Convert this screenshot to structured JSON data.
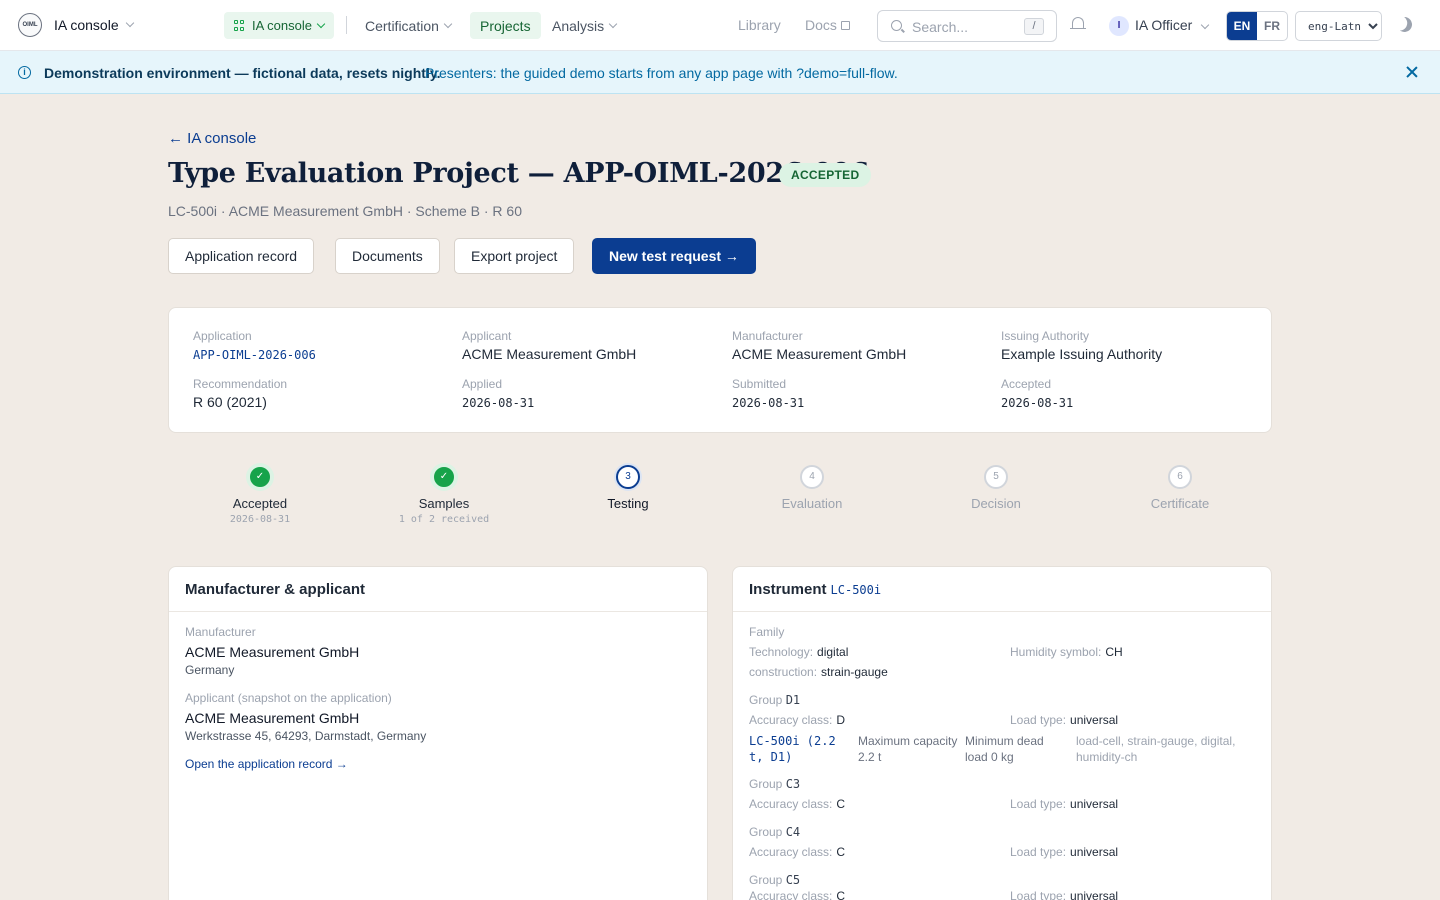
{
  "nav": {
    "logo_text": "OIML",
    "app_title": "IA console",
    "console_pill": "IA console",
    "links": [
      "Certification",
      "Projects",
      "Analysis"
    ],
    "library": "Library",
    "docs": "Docs",
    "search_placeholder": "Search...",
    "search_shortcut": "/",
    "avatar_initial": "I",
    "user_name": "IA Officer",
    "lang_en": "EN",
    "lang_fr": "FR",
    "script_value": "eng-Latn"
  },
  "banner": {
    "strong": "Demonstration environment — fictional data, resets nightly.",
    "text": "Presenters: the guided demo starts from any app page with ?demo=full-flow."
  },
  "header": {
    "back": "← IA console",
    "title": "Type Evaluation Project — APP-OIML-2026-006",
    "status": "ACCEPTED",
    "subtitle": "LC-500i · ACME Measurement GmbH · Scheme B · R 60",
    "buttons": [
      "Application record",
      "Documents",
      "Export project",
      "New test request →"
    ]
  },
  "summary": {
    "application_label": "Application",
    "application": "APP-OIML-2026-006",
    "applicant_label": "Applicant",
    "applicant": "ACME Measurement GmbH",
    "manufacturer_label": "Manufacturer",
    "manufacturer": "ACME Measurement GmbH",
    "authority_label": "Issuing Authority",
    "authority": "Example Issuing Authority",
    "recommendation_label": "Recommendation",
    "recommendation": "R 60 (2021)",
    "applied_label": "Applied",
    "applied": "2026-08-31",
    "submitted_label": "Submitted",
    "submitted": "2026-08-31",
    "accepted_label": "Accepted",
    "accepted": "2026-08-31"
  },
  "steps": [
    {
      "mark": "✓",
      "label": "Accepted",
      "sub": "2026-08-31",
      "state": "done"
    },
    {
      "mark": "✓",
      "label": "Samples",
      "sub": "1 of 2 received",
      "state": "done"
    },
    {
      "mark": "3",
      "label": "Testing",
      "sub": "",
      "state": "current"
    },
    {
      "mark": "4",
      "label": "Evaluation",
      "sub": "",
      "state": "todo"
    },
    {
      "mark": "5",
      "label": "Decision",
      "sub": "",
      "state": "todo"
    },
    {
      "mark": "6",
      "label": "Certificate",
      "sub": "",
      "state": "todo"
    }
  ],
  "manufacturer_panel": {
    "title": "Manufacturer & applicant",
    "manufacturer_label": "Manufacturer",
    "manufacturer_name": "ACME Measurement GmbH",
    "manufacturer_country": "Germany",
    "applicant_label": "Applicant (snapshot on the application)",
    "applicant_name": "ACME Measurement GmbH",
    "applicant_address": "Werkstrasse 45, 64293, Darmstadt, Germany",
    "open_link": "Open the application record →"
  },
  "instrument_panel": {
    "title": "Instrument",
    "model": "LC-500i",
    "family_label": "Family",
    "technology_label": "Technology:",
    "technology": "digital",
    "construction_label": "construction:",
    "construction": "strain-gauge",
    "humidity_label": "Humidity symbol:",
    "humidity": "CH",
    "group_label": "Group",
    "accuracy_label": "Accuracy class:",
    "load_label": "Load type:",
    "groups": [
      {
        "code": "D1",
        "accuracy": "D",
        "load": "universal"
      },
      {
        "code": "C3",
        "accuracy": "C",
        "load": "universal"
      },
      {
        "code": "C4",
        "accuracy": "C",
        "load": "universal"
      },
      {
        "code": "C5",
        "accuracy": "C",
        "load": "universal"
      }
    ],
    "variant": {
      "code": "LC-500i (2.2 t, D1)",
      "max_capacity": "Maximum capacity 2.2 t",
      "min_dead_load": "Minimum dead load 0 kg",
      "tags": "load-cell, strain-gauge, digital, humidity-ch"
    }
  }
}
